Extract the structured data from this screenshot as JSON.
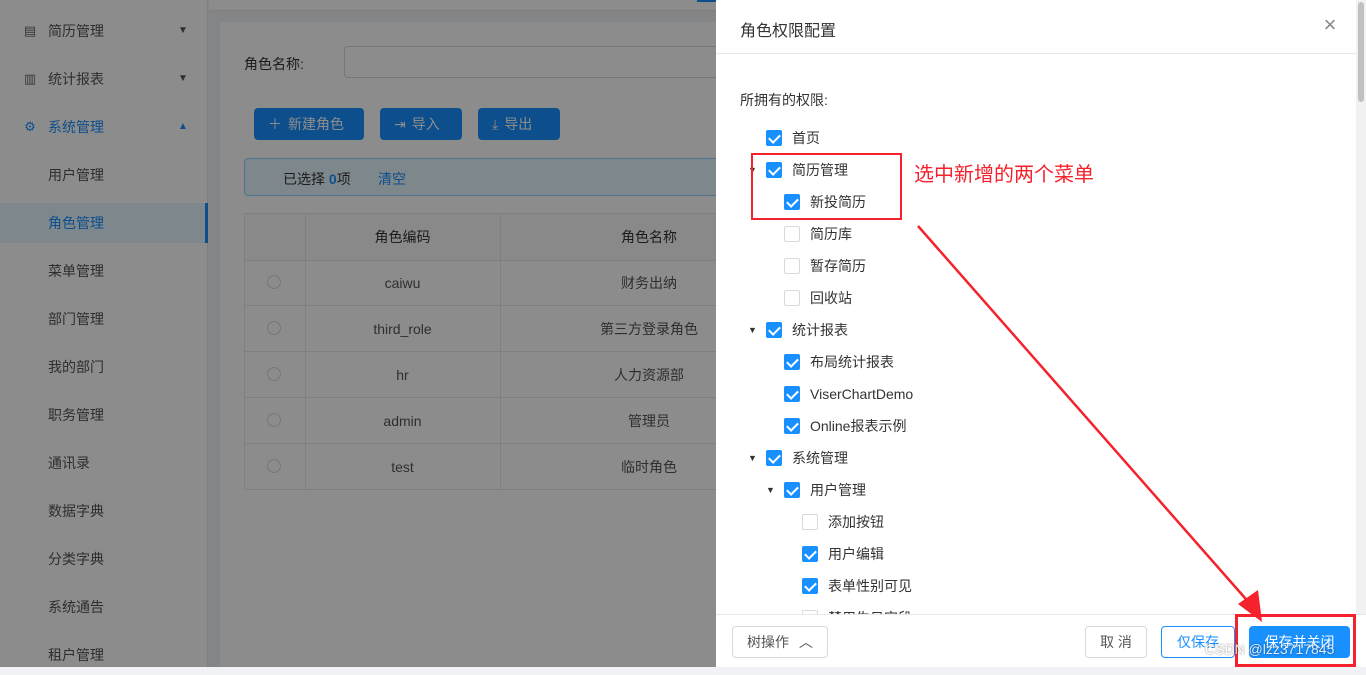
{
  "sidebar": {
    "items": [
      {
        "label": "简历管理",
        "icon": "resume-icon",
        "type": "group"
      },
      {
        "label": "统计报表",
        "icon": "bar-chart-icon",
        "type": "group"
      },
      {
        "label": "系统管理",
        "icon": "gear-icon",
        "type": "group-open"
      },
      {
        "label": "用户管理",
        "type": "sub"
      },
      {
        "label": "角色管理",
        "type": "sub-active"
      },
      {
        "label": "菜单管理",
        "type": "sub"
      },
      {
        "label": "部门管理",
        "type": "sub"
      },
      {
        "label": "我的部门",
        "type": "sub"
      },
      {
        "label": "职务管理",
        "type": "sub"
      },
      {
        "label": "通讯录",
        "type": "sub"
      },
      {
        "label": "数据字典",
        "type": "sub"
      },
      {
        "label": "分类字典",
        "type": "sub"
      },
      {
        "label": "系统通告",
        "type": "sub"
      },
      {
        "label": "租户管理",
        "type": "sub"
      }
    ]
  },
  "main": {
    "search_label": "角色名称:",
    "buttons": {
      "new": "新建角色",
      "import": "导入",
      "export": "导出"
    },
    "alert": {
      "prefix": "已选择 ",
      "count": "0",
      "suffix": "项",
      "clear": "清空"
    },
    "table": {
      "columns": [
        "角色编码",
        "角色名称"
      ],
      "rows": [
        {
          "code": "caiwu",
          "name": "财务出纳"
        },
        {
          "code": "third_role",
          "name": "第三方登录角色"
        },
        {
          "code": "hr",
          "name": "人力资源部"
        },
        {
          "code": "admin",
          "name": "管理员"
        },
        {
          "code": "test",
          "name": "临时角色"
        }
      ]
    }
  },
  "drawer": {
    "title": "角色权限配置",
    "perm_label": "所拥有的权限:",
    "tree": [
      {
        "label": "首页",
        "checked": true,
        "level": 0,
        "caret": false
      },
      {
        "label": "简历管理",
        "checked": true,
        "level": 0,
        "caret": true
      },
      {
        "label": "新投简历",
        "checked": true,
        "level": 1,
        "caret": false
      },
      {
        "label": "简历库",
        "checked": false,
        "level": 1,
        "caret": false
      },
      {
        "label": "暂存简历",
        "checked": false,
        "level": 1,
        "caret": false
      },
      {
        "label": "回收站",
        "checked": false,
        "level": 1,
        "caret": false
      },
      {
        "label": "统计报表",
        "checked": true,
        "level": 0,
        "caret": true
      },
      {
        "label": "布局统计报表",
        "checked": true,
        "level": 1,
        "caret": false
      },
      {
        "label": "ViserChartDemo",
        "checked": true,
        "level": 1,
        "caret": false
      },
      {
        "label": "Online报表示例",
        "checked": true,
        "level": 1,
        "caret": false
      },
      {
        "label": "系统管理",
        "checked": true,
        "level": 0,
        "caret": true
      },
      {
        "label": "用户管理",
        "checked": true,
        "level": 1,
        "caret": true
      },
      {
        "label": "添加按钮",
        "checked": false,
        "level": 2,
        "caret": false
      },
      {
        "label": "用户编辑",
        "checked": true,
        "level": 2,
        "caret": false
      },
      {
        "label": "表单性别可见",
        "checked": true,
        "level": 2,
        "caret": false
      },
      {
        "label": "禁用生日字段",
        "checked": false,
        "level": 2,
        "caret": false
      }
    ],
    "annotation": "选中新增的两个菜单",
    "footer": {
      "tree_ops": "树操作",
      "cancel": "取 消",
      "save_only": "仅保存",
      "save_close": "保存并关闭"
    }
  },
  "watermark": "CSDN @lzz3717845",
  "colors": {
    "primary": "#1890ff",
    "annotation": "#f5222d"
  }
}
